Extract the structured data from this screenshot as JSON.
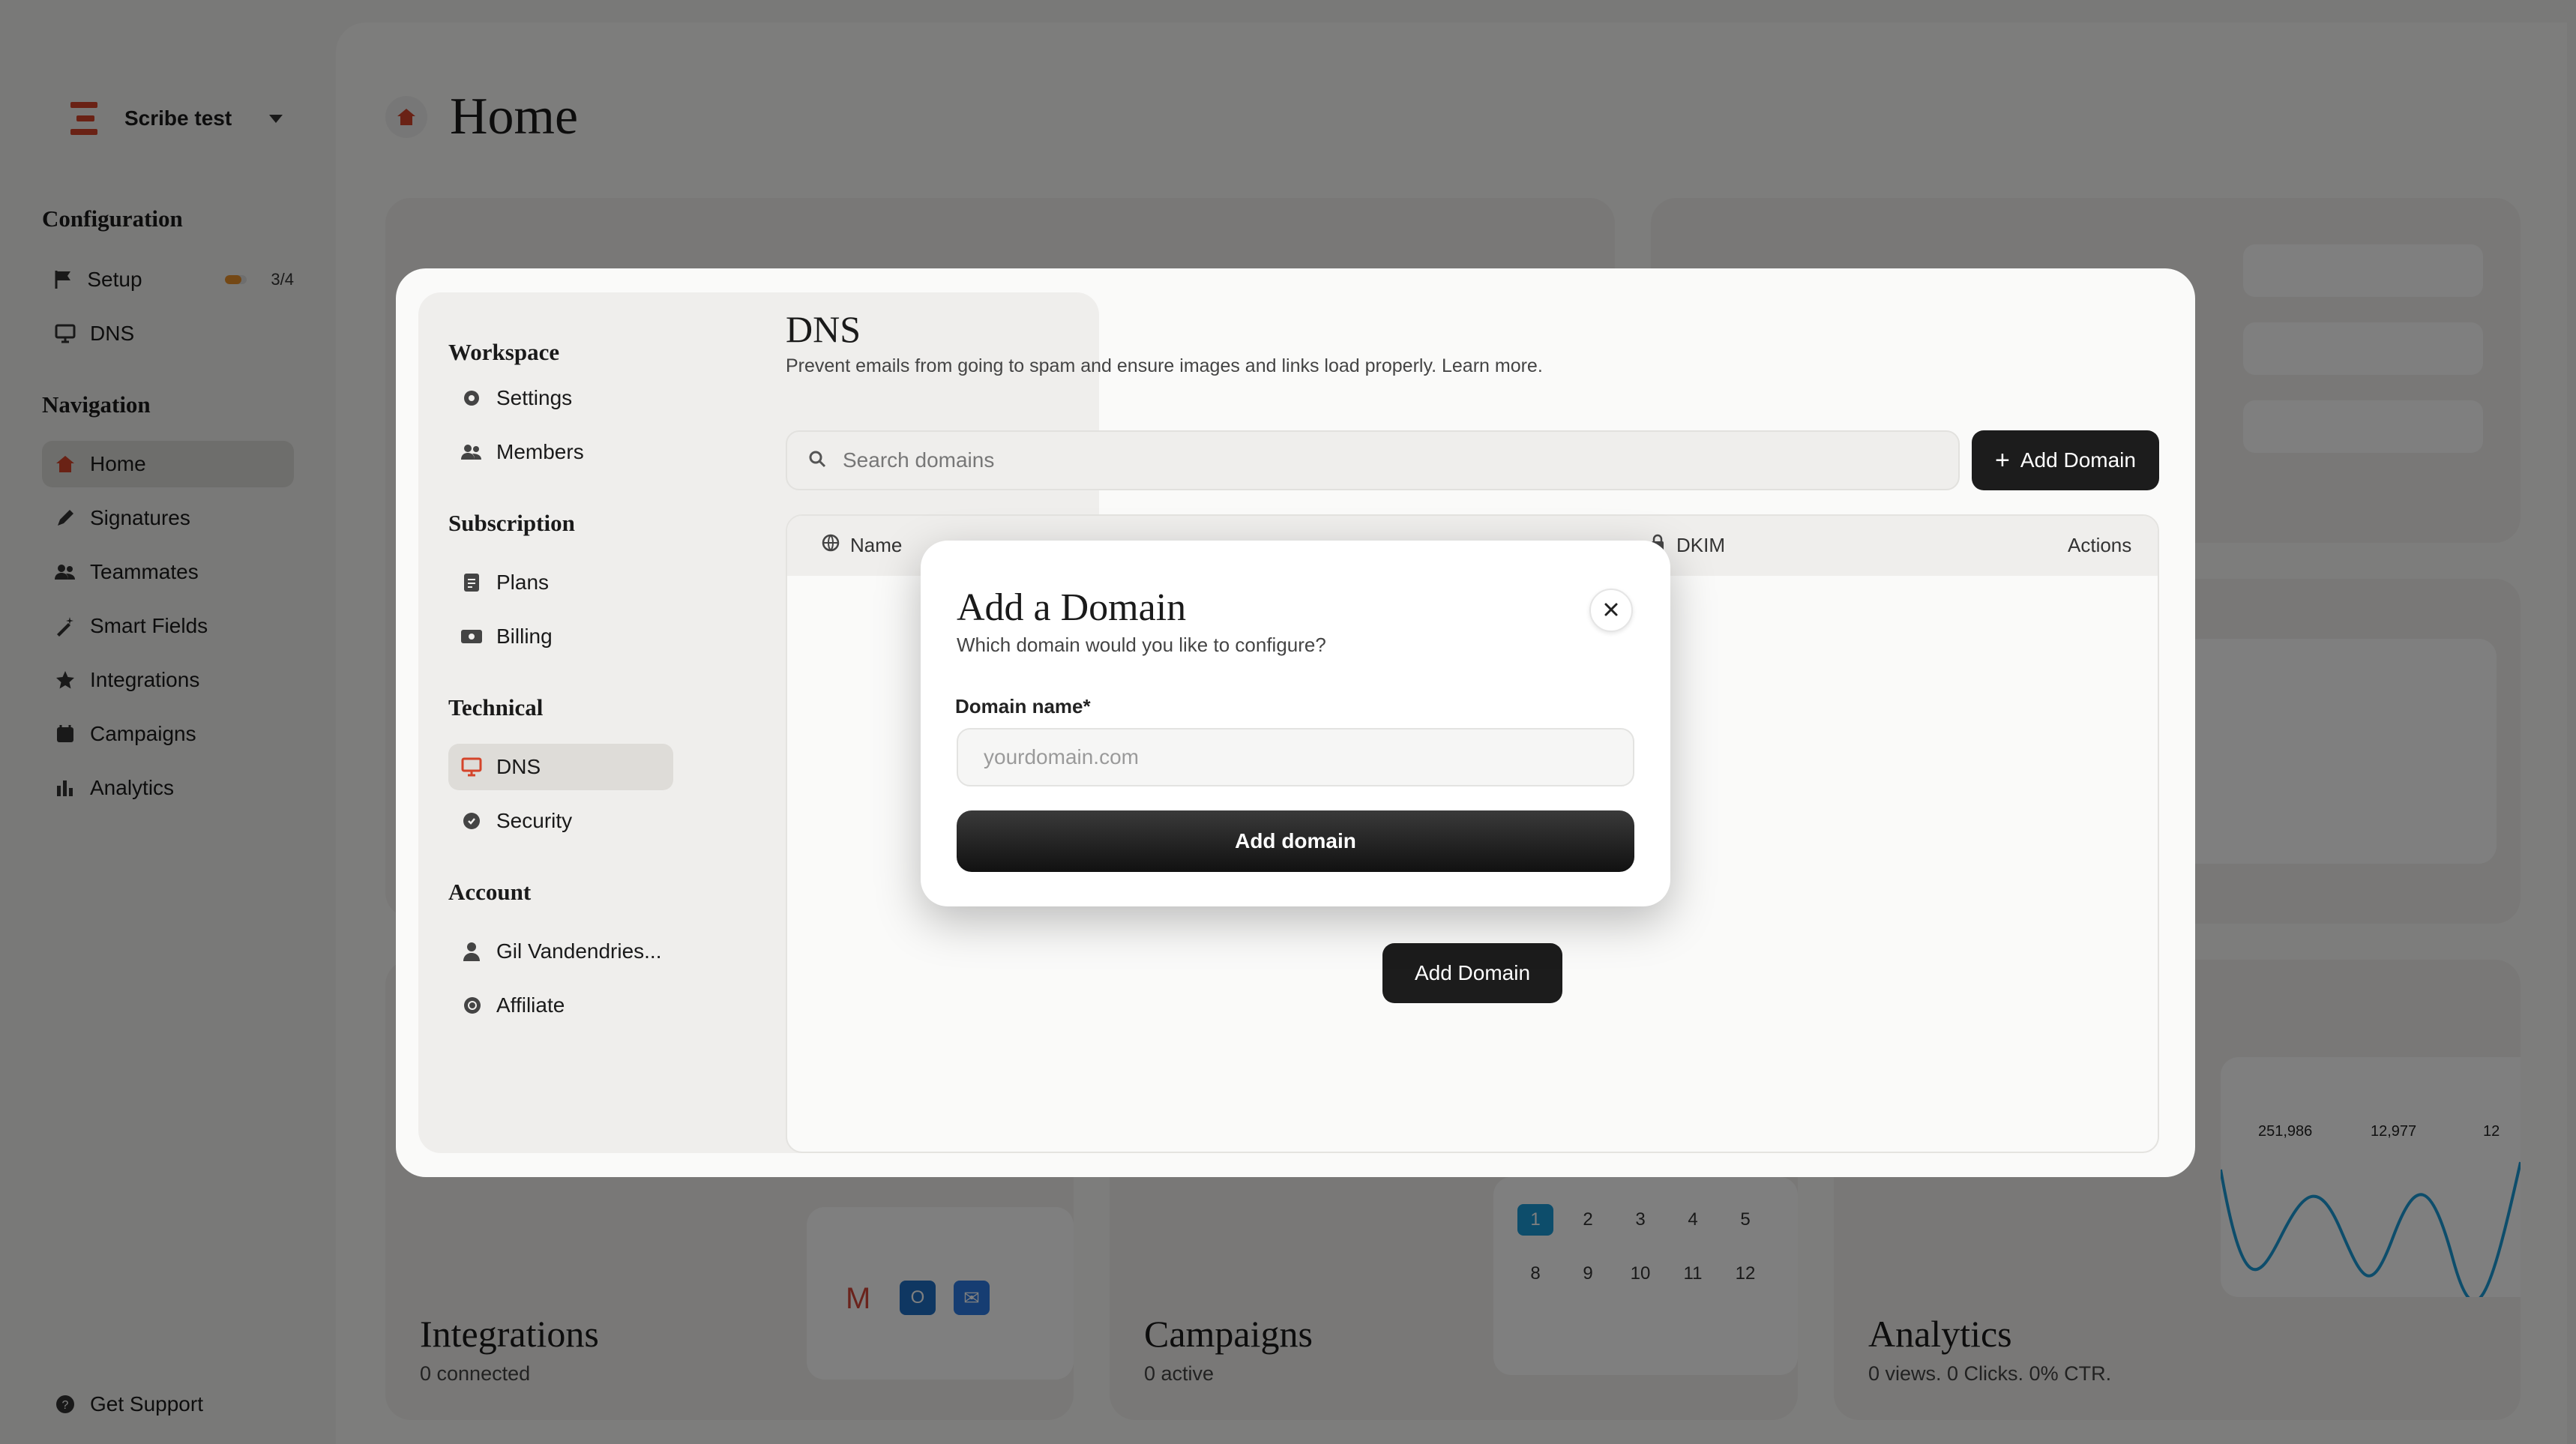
{
  "workspace": {
    "name": "Scribe test"
  },
  "sidebar": {
    "configuration_title": "Configuration",
    "config_items": [
      {
        "label": "Setup",
        "progress_text": "3/4",
        "progress": 0.75
      },
      {
        "label": "DNS"
      }
    ],
    "navigation_title": "Navigation",
    "nav_items": [
      {
        "label": "Home"
      },
      {
        "label": "Signatures"
      },
      {
        "label": "Teammates"
      },
      {
        "label": "Smart Fields"
      },
      {
        "label": "Integrations"
      },
      {
        "label": "Campaigns"
      },
      {
        "label": "Analytics"
      }
    ],
    "support_label": "Get Support"
  },
  "main": {
    "title": "Home",
    "cards": {
      "integrations": {
        "title": "Integrations",
        "sub": "0 connected"
      },
      "campaigns": {
        "title": "Campaigns",
        "sub": "0 active",
        "calendar": [
          "1",
          "2",
          "3",
          "4",
          "5",
          "8",
          "9",
          "10",
          "11",
          "12"
        ]
      },
      "analytics": {
        "title": "Analytics",
        "sub": "0 views. 0 Clicks. 0% CTR.",
        "stats": [
          "251,986",
          "12,977",
          "12"
        ]
      }
    }
  },
  "settings": {
    "sections": [
      {
        "title": "Workspace",
        "items": [
          "Settings",
          "Members"
        ]
      },
      {
        "title": "Subscription",
        "items": [
          "Plans",
          "Billing"
        ]
      },
      {
        "title": "Technical",
        "items": [
          "DNS",
          "Security"
        ]
      },
      {
        "title": "Account",
        "items": [
          "Gil Vandendries...",
          "Affiliate"
        ]
      }
    ],
    "active_item": "DNS"
  },
  "dns": {
    "title": "DNS",
    "description": "Prevent emails from going to spam and ensure images and links load properly. Learn more.",
    "search_placeholder": "Search domains",
    "add_button": "Add Domain",
    "columns": [
      "Name",
      "DKIM",
      "Actions"
    ],
    "empty_add_button": "Add Domain"
  },
  "dialog": {
    "title": "Add a Domain",
    "subtitle": "Which domain would you like to configure?",
    "field_label": "Domain name*",
    "field_placeholder": "yourdomain.com",
    "field_value": "",
    "submit_label": "Add domain"
  },
  "colors": {
    "brand": "#d4442a",
    "dark_button": "#1c1c1c",
    "progress": "#e8902a"
  }
}
